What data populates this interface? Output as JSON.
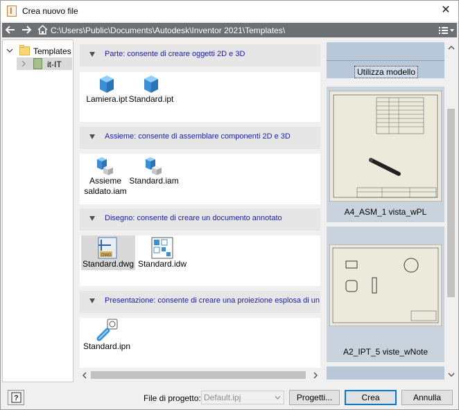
{
  "window": {
    "title": "Crea nuovo file",
    "close_glyph": "✕"
  },
  "pathbar": {
    "path": "C:\\Users\\Public\\Documents\\Autodesk\\Inventor 2021\\Templates\\"
  },
  "tree": [
    {
      "label": "Templates",
      "icon": "folder-icon"
    },
    {
      "label": "it-IT",
      "icon": "locale-folder-icon"
    }
  ],
  "sections": [
    {
      "title": "Parte: consente di creare oggetti 2D e 3D",
      "items": [
        {
          "label": "Lamiera.ipt",
          "icon": "part-icon"
        },
        {
          "label": "Standard.ipt",
          "icon": "part-icon"
        }
      ]
    },
    {
      "title": "Assieme: consente di assemblare componenti 2D e 3D",
      "items": [
        {
          "label": "Assieme saldato.iam",
          "icon": "assembly-icon"
        },
        {
          "label": "Standard.iam",
          "icon": "assembly-icon"
        }
      ]
    },
    {
      "title": "Disegno: consente di creare un documento annotato",
      "items": [
        {
          "label": "Standard.dwg",
          "icon": "dwg-icon"
        },
        {
          "label": "Standard.idw",
          "icon": "idw-icon"
        }
      ]
    },
    {
      "title": "Presentazione: consente di creare una proiezione esplosa di un a",
      "items": [
        {
          "label": "Standard.ipn",
          "icon": "presentation-icon"
        }
      ]
    }
  ],
  "previews": {
    "use_template": "Utilizza modello",
    "items": [
      {
        "label": "A4_ASM_1 vista_wPL"
      },
      {
        "label": "A2_IPT_5 viste_wNote"
      }
    ]
  },
  "footer": {
    "project_label": "File di progetto:",
    "project_value": "Default.ipj",
    "projects_button": "Progetti...",
    "create_button": "Crea",
    "cancel_button": "Annulla"
  },
  "colors": {
    "section_title": "#1a1ab8",
    "pathbar_bg": "#6d7072",
    "part_blue": "#3b8fd6"
  }
}
